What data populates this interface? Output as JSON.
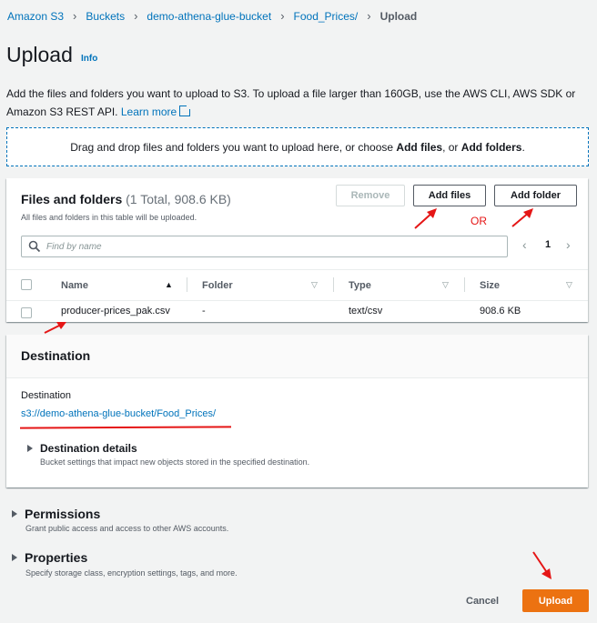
{
  "breadcrumb": [
    "Amazon S3",
    "Buckets",
    "demo-athena-glue-bucket",
    "Food_Prices/",
    "Upload"
  ],
  "page": {
    "title": "Upload",
    "info": "Info",
    "description": "Add the files and folders you want to upload to S3. To upload a file larger than 160GB, use the AWS CLI, AWS SDK or Amazon S3 REST API.",
    "learn_more": "Learn more"
  },
  "dropzone": {
    "prefix": "Drag and drop files and folders you want to upload here, or choose ",
    "add_files": "Add files",
    "middle": ", or ",
    "add_folders": "Add folders",
    "suffix": "."
  },
  "files_panel": {
    "title": "Files and folders",
    "count": "(1 Total, 908.6 KB)",
    "subtitle": "All files and folders in this table will be uploaded.",
    "remove": "Remove",
    "add_files": "Add files",
    "add_folder": "Add folder",
    "or_annotation": "OR",
    "search_placeholder": "Find by name",
    "page_number": "1",
    "columns": [
      "Name",
      "Folder",
      "Type",
      "Size"
    ],
    "rows": [
      {
        "name": "producer-prices_pak.csv",
        "folder": "-",
        "type": "text/csv",
        "size": "908.6 KB"
      }
    ]
  },
  "destination": {
    "header": "Destination",
    "label": "Destination",
    "path": "s3://demo-athena-glue-bucket/Food_Prices/",
    "details_title": "Destination details",
    "details_sub": "Bucket settings that impact new objects stored in the specified destination."
  },
  "permissions": {
    "title": "Permissions",
    "sub": "Grant public access and access to other AWS accounts."
  },
  "properties": {
    "title": "Properties",
    "sub": "Specify storage class, encryption settings, tags, and more."
  },
  "footer": {
    "cancel": "Cancel",
    "upload": "Upload"
  },
  "colors": {
    "link": "#0073bb",
    "primary": "#ec7211",
    "annotation": "#e51616"
  }
}
